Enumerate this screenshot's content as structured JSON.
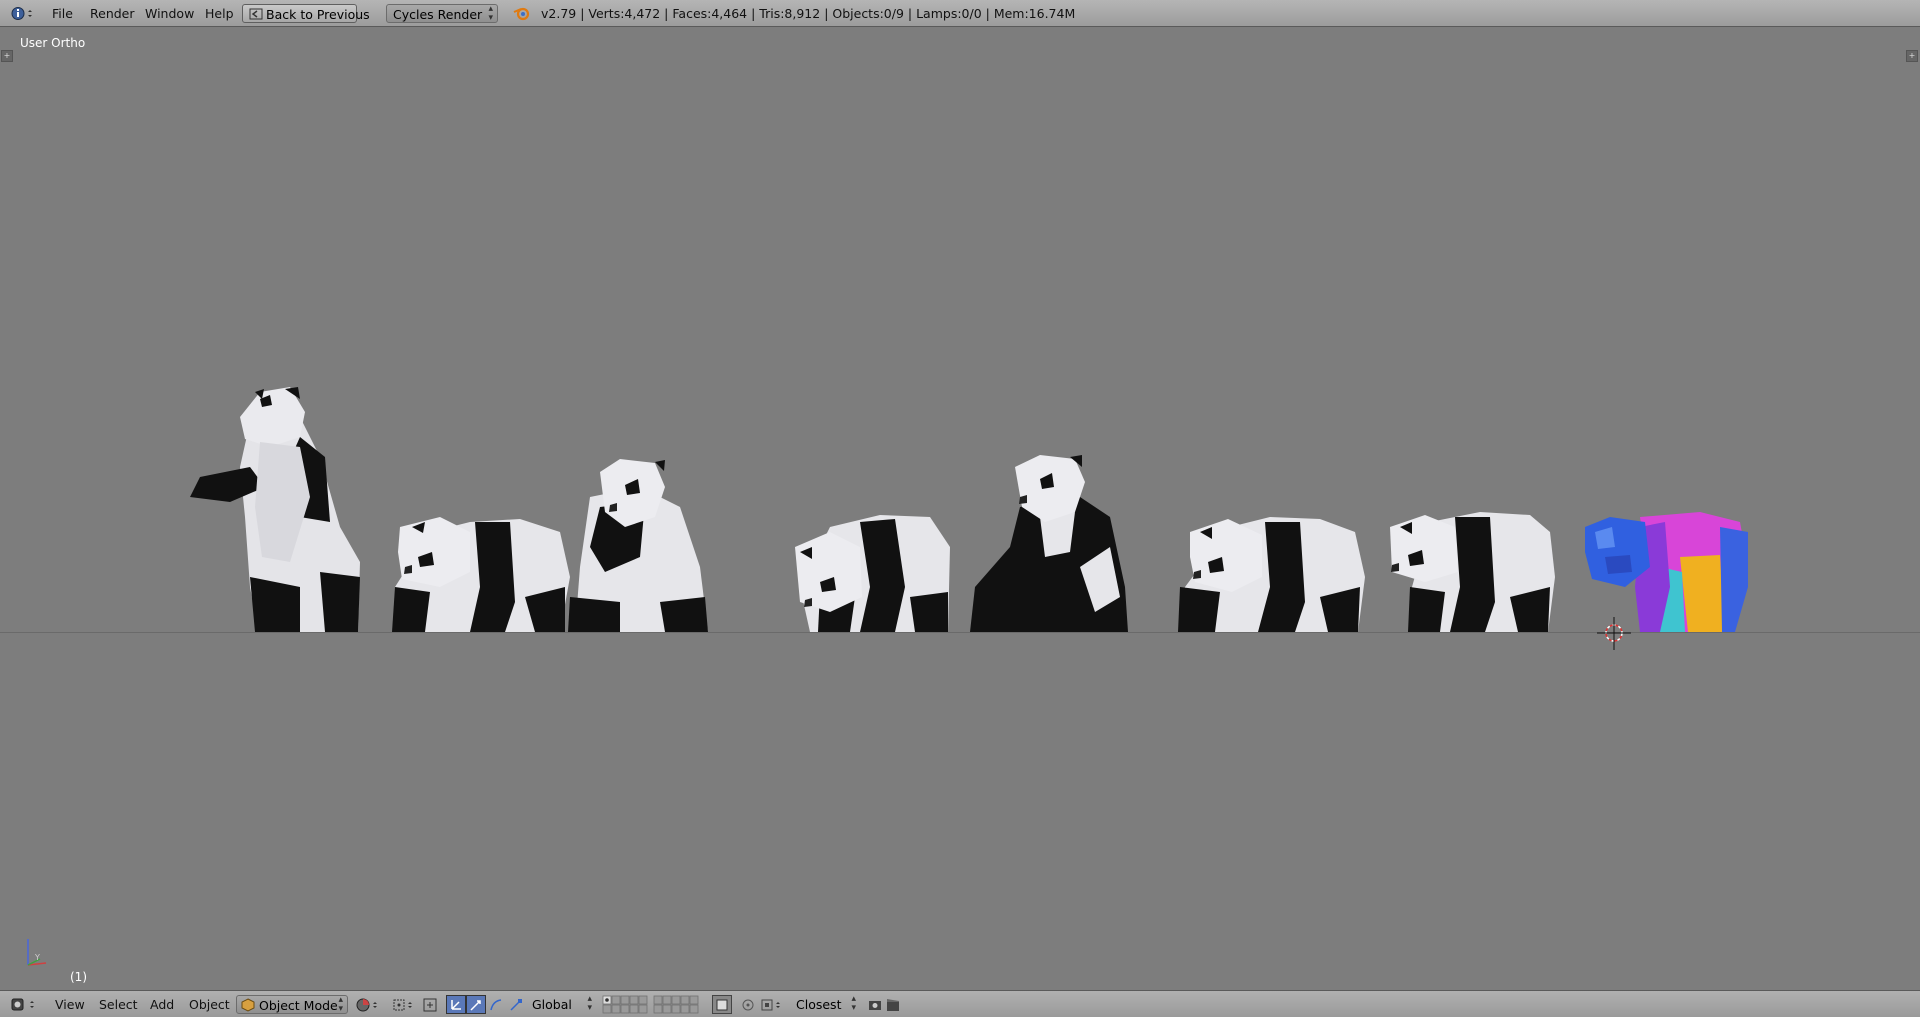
{
  "topbar": {
    "menu": [
      "File",
      "Render",
      "Window",
      "Help"
    ],
    "back_button": "Back to Previous",
    "render_engine": "Cycles Render",
    "stats": "v2.79 | Verts:4,472 | Faces:4,464 | Tris:8,912 | Objects:0/9 | Lamps:0/0 | Mem:16.74M"
  },
  "viewport": {
    "view_name": "User Ortho",
    "frame": "(1)"
  },
  "bottombar": {
    "menu": [
      "View",
      "Select",
      "Add",
      "Object"
    ],
    "mode": "Object Mode",
    "orientation": "Global",
    "snap_target": "Closest"
  },
  "colors": {
    "background": "#7d7d7d",
    "panda_black": "#111111",
    "panda_white": "#e6e6ea"
  }
}
